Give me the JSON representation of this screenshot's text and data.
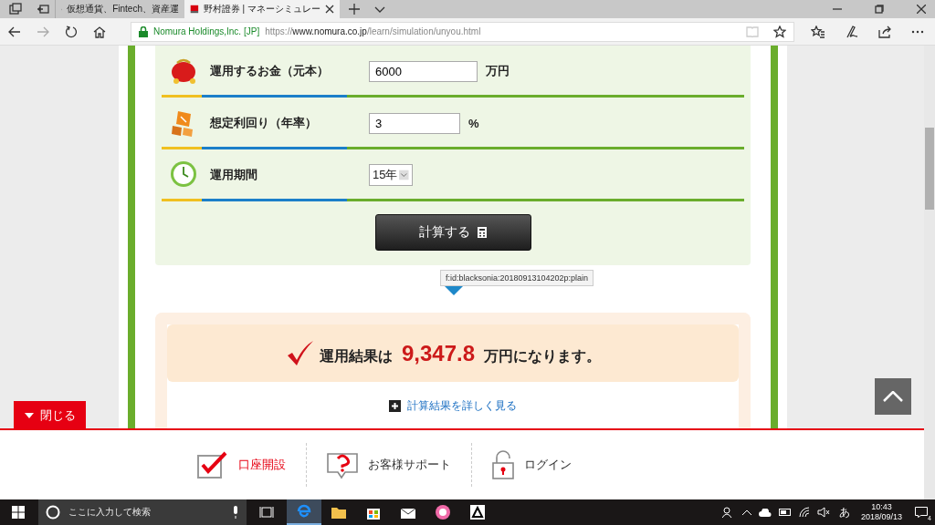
{
  "browser": {
    "tabs": [
      {
        "title": "仮想通貨、Fintech、資産運",
        "selected": false
      },
      {
        "title": "野村證券 | マネーシミュレー",
        "selected": true
      }
    ],
    "address": {
      "identity": "Nomura Holdings,Inc. [JP]",
      "scheme": "https://",
      "host": "www.nomura.co.jp",
      "path": "/learn/simulation/unyou.html"
    }
  },
  "form": {
    "rows": [
      {
        "kind": "input",
        "label": "運用するお金（元本）",
        "value": "6000",
        "unit": "万円"
      },
      {
        "kind": "input",
        "label": "想定利回り（年率）",
        "value": "3",
        "unit": "%"
      },
      {
        "kind": "select",
        "label": "運用期間",
        "value": "15年"
      }
    ],
    "submit": "計算する"
  },
  "tooltip": "f:id:blacksonia:20180913104202p:plain",
  "result": {
    "prefix": "運用結果は",
    "amount": "9,347.8",
    "suffix": "万円になります。",
    "details_link": "計算結果を詳しく見る"
  },
  "close_button": "閉じる",
  "footer_links": [
    {
      "kind": "account",
      "label": "口座開設"
    },
    {
      "kind": "support",
      "label": "お客様サポート"
    },
    {
      "kind": "login",
      "label": "ログイン"
    }
  ],
  "taskbar": {
    "search_placeholder": "ここに入力して検索",
    "ime": "あ",
    "time": "10:43",
    "date": "2018/09/13",
    "notifications": "4"
  }
}
